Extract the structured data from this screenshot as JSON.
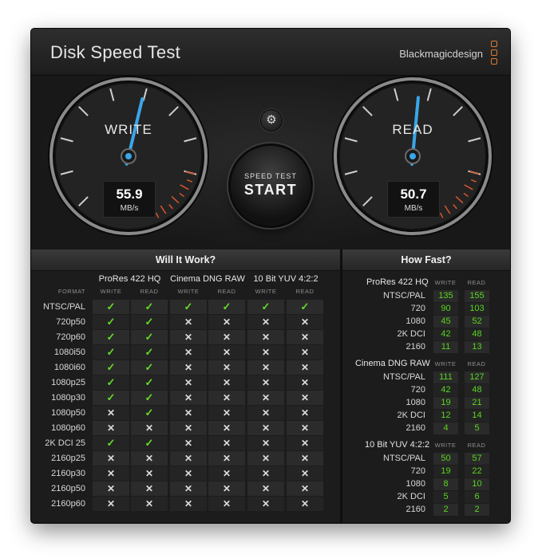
{
  "window": {
    "close_glyph": "✕",
    "title": "Disk Speed Test",
    "brand": "Blackmagicdesign"
  },
  "gauges": {
    "write": {
      "label": "WRITE",
      "value": "55.9",
      "unit": "MB/s"
    },
    "read": {
      "label": "READ",
      "value": "50.7",
      "unit": "MB/s"
    },
    "needle_fraction": {
      "write": 0.55,
      "read": 0.52
    }
  },
  "settings_icon": "gear-icon",
  "settings_glyph": "⚙",
  "start_button": {
    "small": "SPEED TEST",
    "big": "START"
  },
  "will_it_work": {
    "title": "Will It Work?",
    "format_header": "FORMAT",
    "groups": [
      "ProRes 422 HQ",
      "Cinema DNG RAW",
      "10 Bit YUV 4:2:2"
    ],
    "sub": [
      "WRITE",
      "READ"
    ],
    "rows": [
      {
        "format": "NTSC/PAL",
        "cells": [
          "✓",
          "✓",
          "✓",
          "✓",
          "✓",
          "✓"
        ]
      },
      {
        "format": "720p50",
        "cells": [
          "✓",
          "✓",
          "✕",
          "✕",
          "✕",
          "✕"
        ]
      },
      {
        "format": "720p60",
        "cells": [
          "✓",
          "✓",
          "✕",
          "✕",
          "✕",
          "✕"
        ]
      },
      {
        "format": "1080i50",
        "cells": [
          "✓",
          "✓",
          "✕",
          "✕",
          "✕",
          "✕"
        ]
      },
      {
        "format": "1080i60",
        "cells": [
          "✓",
          "✓",
          "✕",
          "✕",
          "✕",
          "✕"
        ]
      },
      {
        "format": "1080p25",
        "cells": [
          "✓",
          "✓",
          "✕",
          "✕",
          "✕",
          "✕"
        ]
      },
      {
        "format": "1080p30",
        "cells": [
          "✓",
          "✓",
          "✕",
          "✕",
          "✕",
          "✕"
        ]
      },
      {
        "format": "1080p50",
        "cells": [
          "✕",
          "✓",
          "✕",
          "✕",
          "✕",
          "✕"
        ]
      },
      {
        "format": "1080p60",
        "cells": [
          "✕",
          "✕",
          "✕",
          "✕",
          "✕",
          "✕"
        ]
      },
      {
        "format": "2K DCI 25",
        "cells": [
          "✓",
          "✓",
          "✕",
          "✕",
          "✕",
          "✕"
        ]
      },
      {
        "format": "2160p25",
        "cells": [
          "✕",
          "✕",
          "✕",
          "✕",
          "✕",
          "✕"
        ]
      },
      {
        "format": "2160p30",
        "cells": [
          "✕",
          "✕",
          "✕",
          "✕",
          "✕",
          "✕"
        ]
      },
      {
        "format": "2160p50",
        "cells": [
          "✕",
          "✕",
          "✕",
          "✕",
          "✕",
          "✕"
        ]
      },
      {
        "format": "2160p60",
        "cells": [
          "✕",
          "✕",
          "✕",
          "✕",
          "✕",
          "✕"
        ]
      }
    ]
  },
  "how_fast": {
    "title": "How Fast?",
    "sub": [
      "WRITE",
      "READ"
    ],
    "groups": [
      {
        "name": "ProRes 422 HQ",
        "rows": [
          {
            "format": "NTSC/PAL",
            "write": "135",
            "read": "155"
          },
          {
            "format": "720",
            "write": "90",
            "read": "103"
          },
          {
            "format": "1080",
            "write": "45",
            "read": "52"
          },
          {
            "format": "2K DCI",
            "write": "42",
            "read": "48"
          },
          {
            "format": "2160",
            "write": "11",
            "read": "13"
          }
        ]
      },
      {
        "name": "Cinema DNG RAW",
        "rows": [
          {
            "format": "NTSC/PAL",
            "write": "111",
            "read": "127"
          },
          {
            "format": "720",
            "write": "42",
            "read": "48"
          },
          {
            "format": "1080",
            "write": "19",
            "read": "21"
          },
          {
            "format": "2K DCI",
            "write": "12",
            "read": "14"
          },
          {
            "format": "2160",
            "write": "4",
            "read": "5"
          }
        ]
      },
      {
        "name": "10 Bit YUV 4:2:2",
        "rows": [
          {
            "format": "NTSC/PAL",
            "write": "50",
            "read": "57"
          },
          {
            "format": "720",
            "write": "19",
            "read": "22"
          },
          {
            "format": "1080",
            "write": "8",
            "read": "10"
          },
          {
            "format": "2K DCI",
            "write": "5",
            "read": "6"
          },
          {
            "format": "2160",
            "write": "2",
            "read": "2"
          }
        ]
      }
    ]
  },
  "colors": {
    "ok": "#64dc28",
    "value": "#59d61e",
    "needle": "#3aa6e8",
    "redline": "#d9562b",
    "brand_accent": "#e07a2e"
  }
}
